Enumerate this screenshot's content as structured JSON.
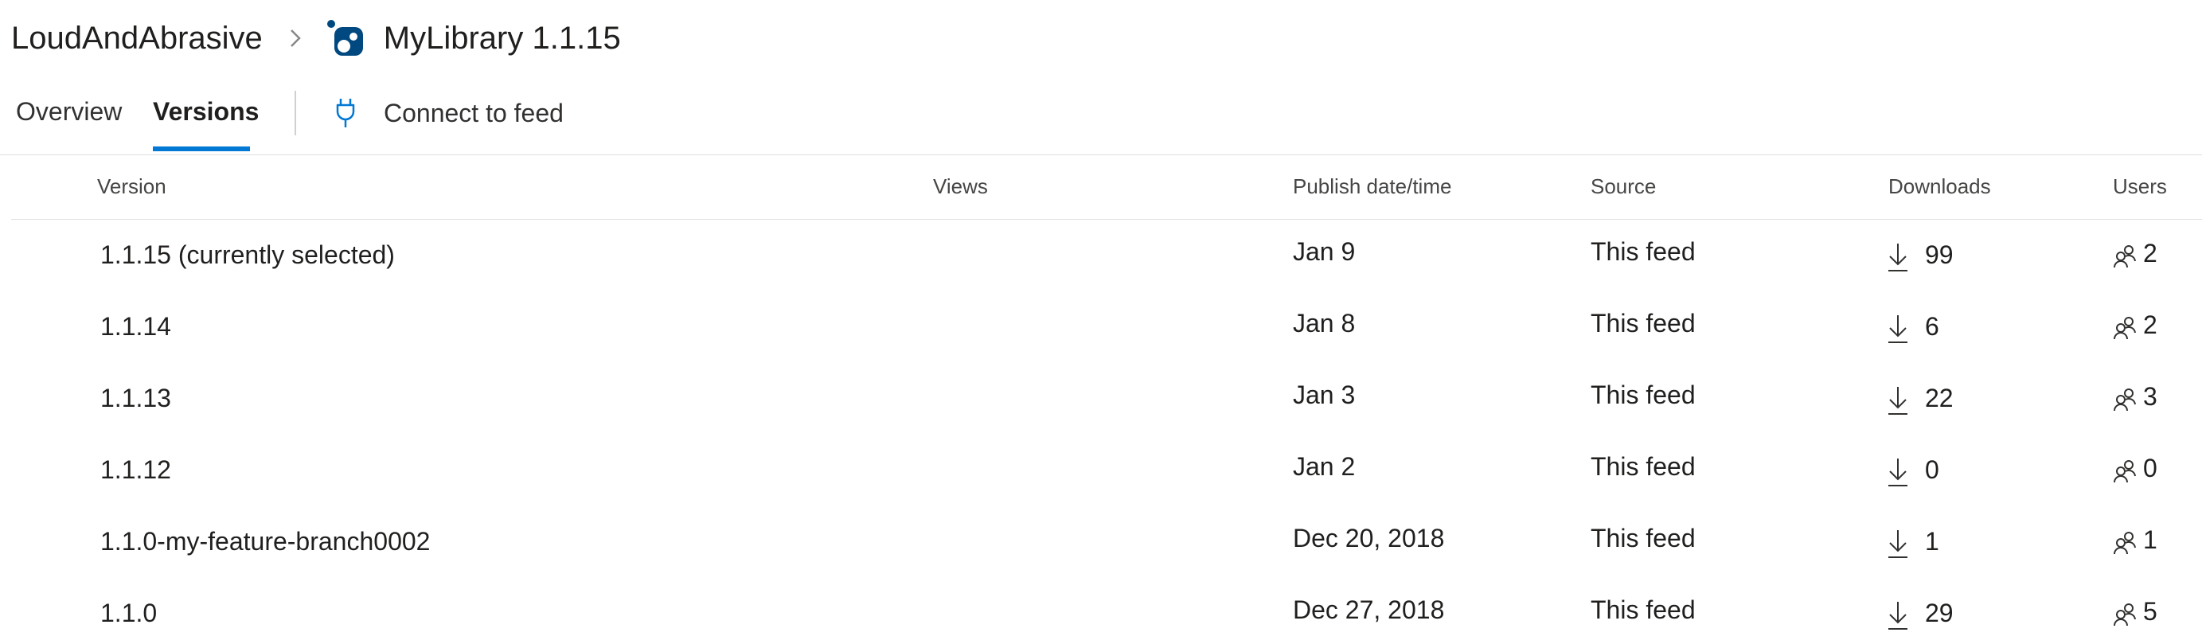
{
  "breadcrumb": {
    "feed_name": "LoudAndAbrasive",
    "package_title": "MyLibrary 1.1.15"
  },
  "tabs": [
    {
      "label": "Overview",
      "selected": false
    },
    {
      "label": "Versions",
      "selected": true
    }
  ],
  "connect_label": "Connect to feed",
  "colors": {
    "accent": "#0078d4",
    "package_icon": "#004880"
  },
  "table": {
    "headers": {
      "version": "Version",
      "views": "Views",
      "publish": "Publish date/time",
      "source": "Source",
      "downloads": "Downloads",
      "users": "Users"
    },
    "rows": [
      {
        "version": "1.1.15 (currently selected)",
        "date": "Jan 9",
        "source": "This feed",
        "downloads": "99",
        "users": "2"
      },
      {
        "version": "1.1.14",
        "date": "Jan 8",
        "source": "This feed",
        "downloads": "6",
        "users": "2"
      },
      {
        "version": "1.1.13",
        "date": "Jan 3",
        "source": "This feed",
        "downloads": "22",
        "users": "3"
      },
      {
        "version": "1.1.12",
        "date": "Jan 2",
        "source": "This feed",
        "downloads": "0",
        "users": "0"
      },
      {
        "version": "1.1.0-my-feature-branch0002",
        "date": "Dec 20, 2018",
        "source": "This feed",
        "downloads": "1",
        "users": "1"
      },
      {
        "version": "1.1.0",
        "date": "Dec 27, 2018",
        "source": "This feed",
        "downloads": "29",
        "users": "5"
      }
    ]
  }
}
